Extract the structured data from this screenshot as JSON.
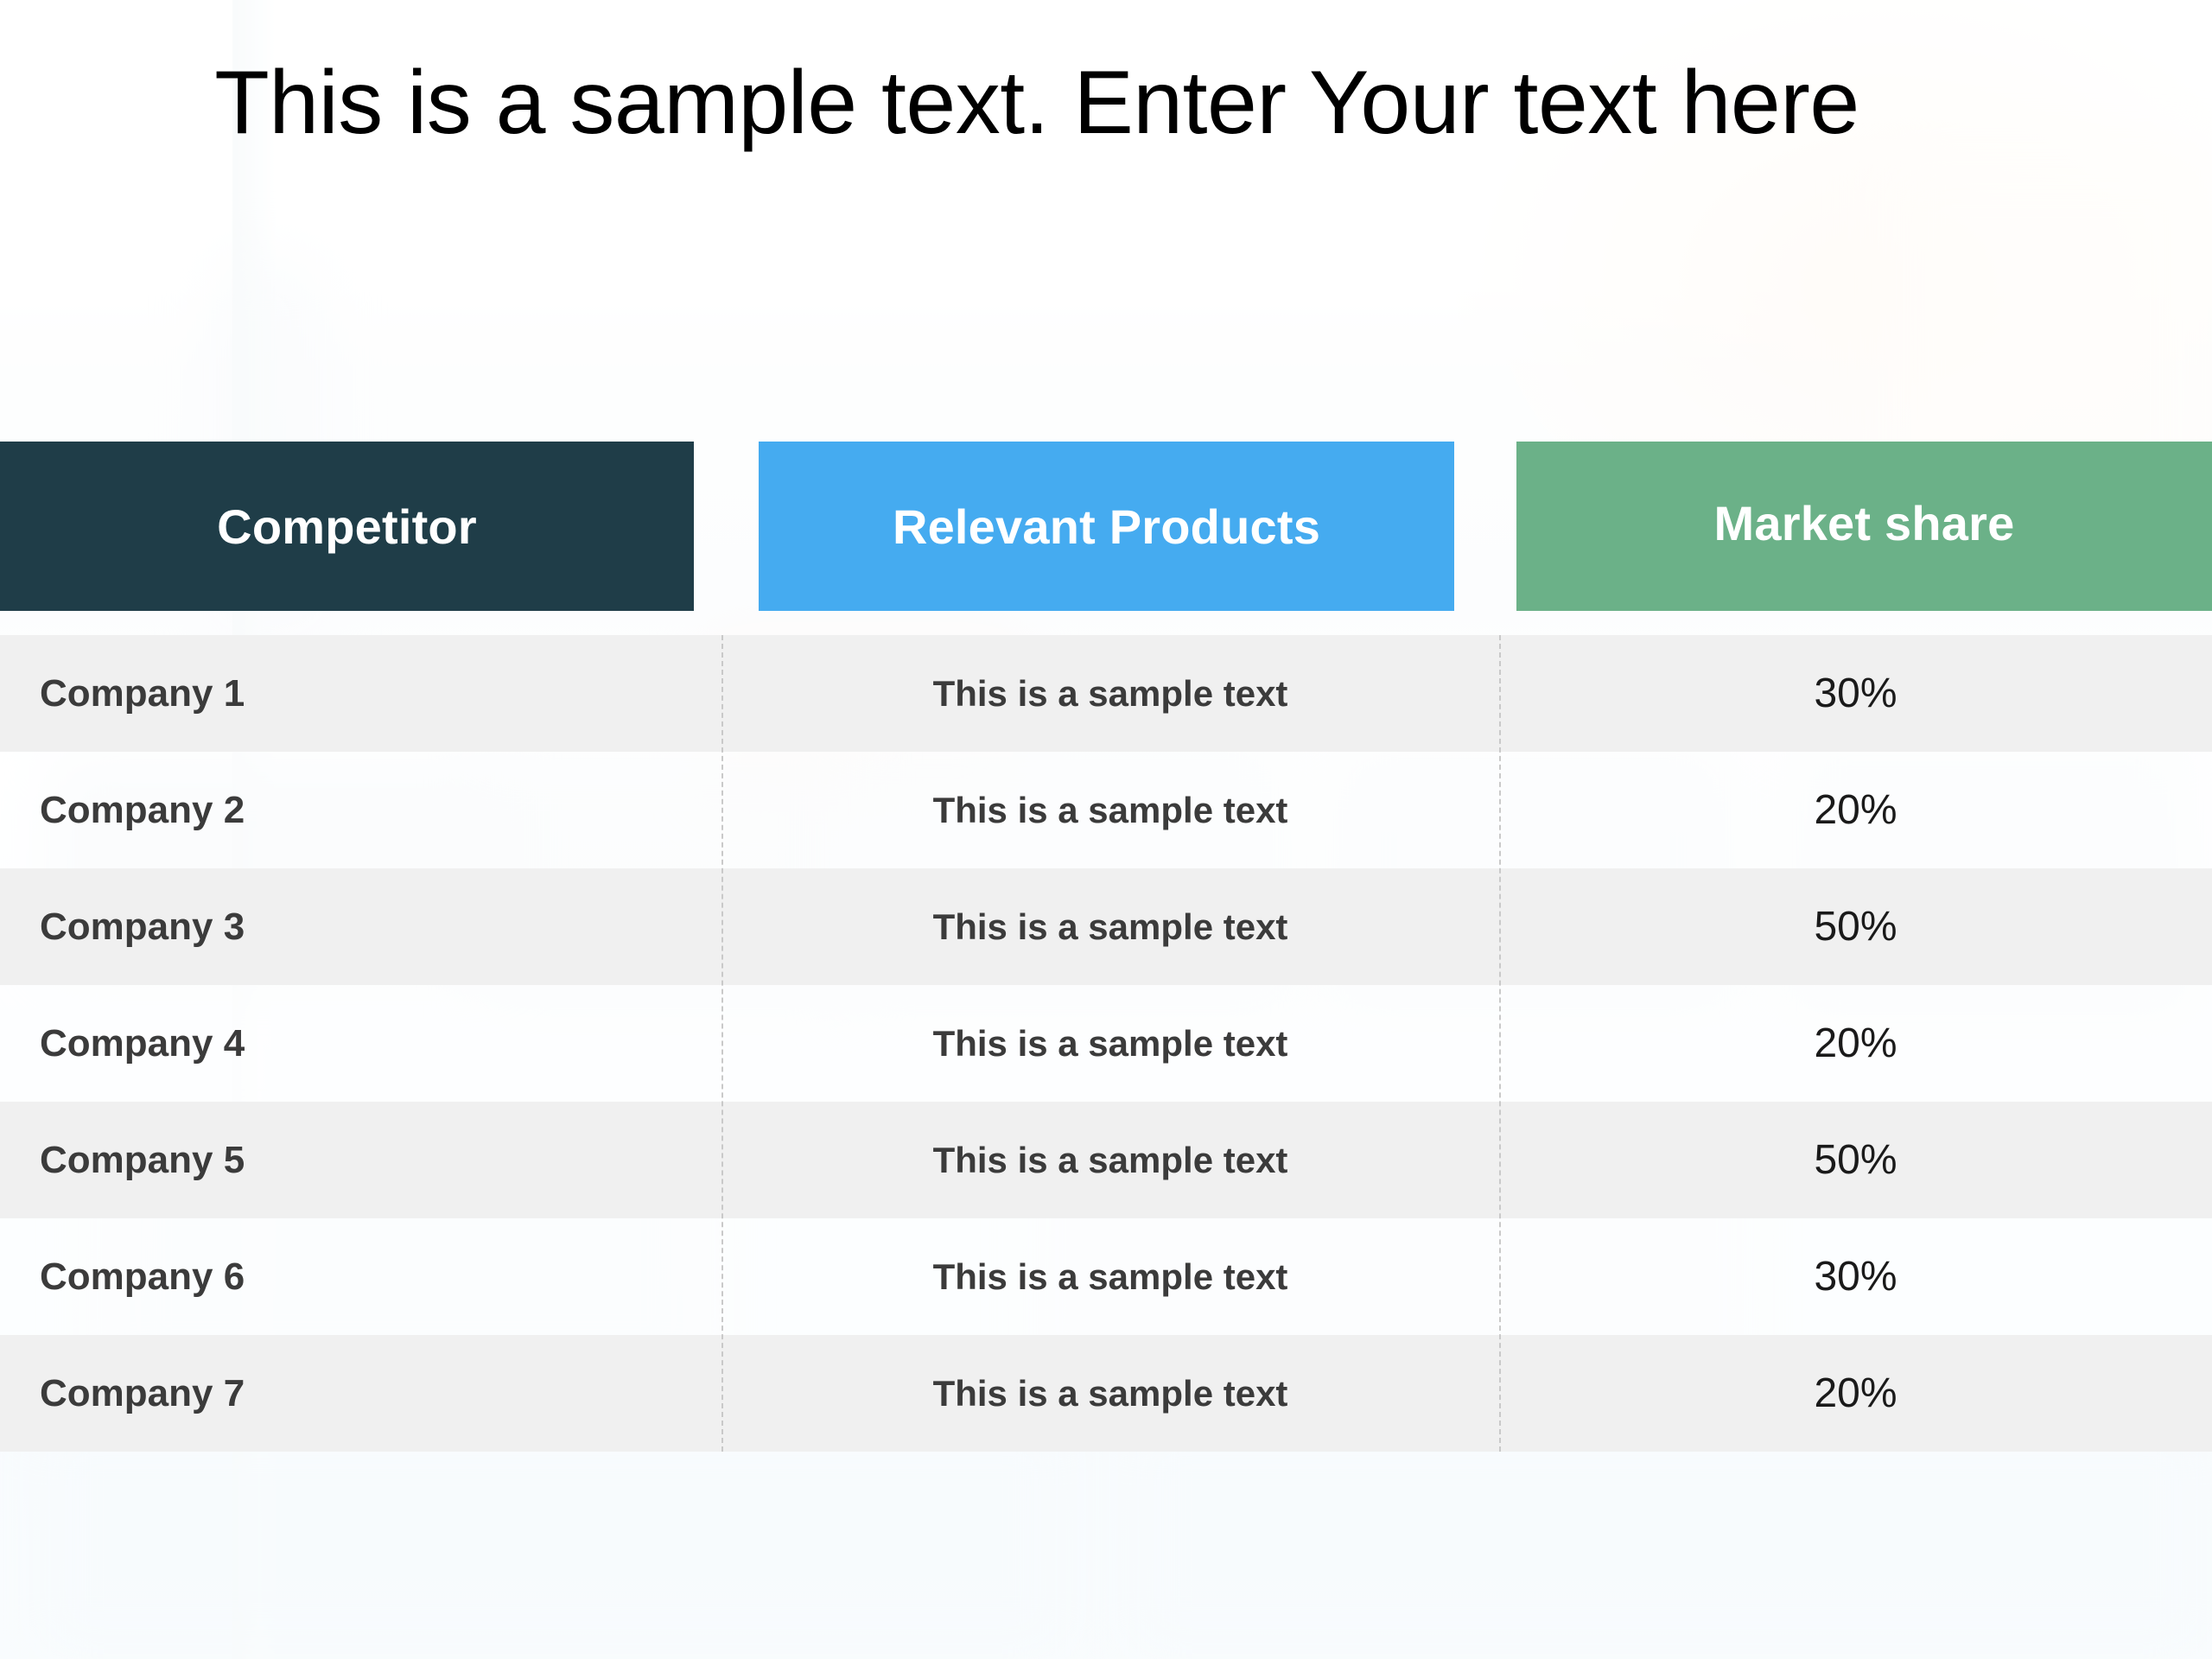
{
  "slide": {
    "title": "This is a sample text. Enter Your text here",
    "background_style": "faded-office-photo"
  },
  "colors": {
    "header_competitor_bg": "#1f3d48",
    "header_products_bg": "#45abf0",
    "header_share_bg": "#6bb188",
    "header_text": "#ffffff",
    "row_odd_bg": "#efefef",
    "row_even_bg": "#ffffff",
    "body_text": "#3b3b3b",
    "share_text": "#1a1a1a",
    "divider": "#c9c9c9",
    "title_text": "#000000"
  },
  "table": {
    "columns": [
      {
        "key": "competitor",
        "label": "Competitor"
      },
      {
        "key": "products",
        "label": "Relevant Products"
      },
      {
        "key": "share",
        "label": "Market share"
      }
    ],
    "rows": [
      {
        "competitor": "Company 1",
        "products": "This is a sample text",
        "share": "30%"
      },
      {
        "competitor": "Company 2",
        "products": "This is a sample text",
        "share": "20%"
      },
      {
        "competitor": "Company 3",
        "products": "This is a sample text",
        "share": "50%"
      },
      {
        "competitor": "Company 4",
        "products": "This is a sample text",
        "share": "20%"
      },
      {
        "competitor": "Company 5",
        "products": "This is a sample text",
        "share": "50%"
      },
      {
        "competitor": "Company 6",
        "products": "This is a sample text",
        "share": "30%"
      },
      {
        "competitor": "Company 7",
        "products": "This is a sample text",
        "share": "20%"
      }
    ]
  },
  "chart_data": {
    "type": "table",
    "title": "This is a sample text. Enter Your text here",
    "columns": [
      "Competitor",
      "Relevant Products",
      "Market share"
    ],
    "categories": [
      "Company 1",
      "Company 2",
      "Company 3",
      "Company 4",
      "Company 5",
      "Company 6",
      "Company 7"
    ],
    "series": [
      {
        "name": "Market share",
        "values": [
          30,
          20,
          50,
          20,
          50,
          30,
          20
        ],
        "unit": "%"
      }
    ],
    "xlabel": "Competitor",
    "ylabel": "Market share",
    "ylim": [
      0,
      100
    ],
    "grid": false,
    "legend": "none"
  }
}
